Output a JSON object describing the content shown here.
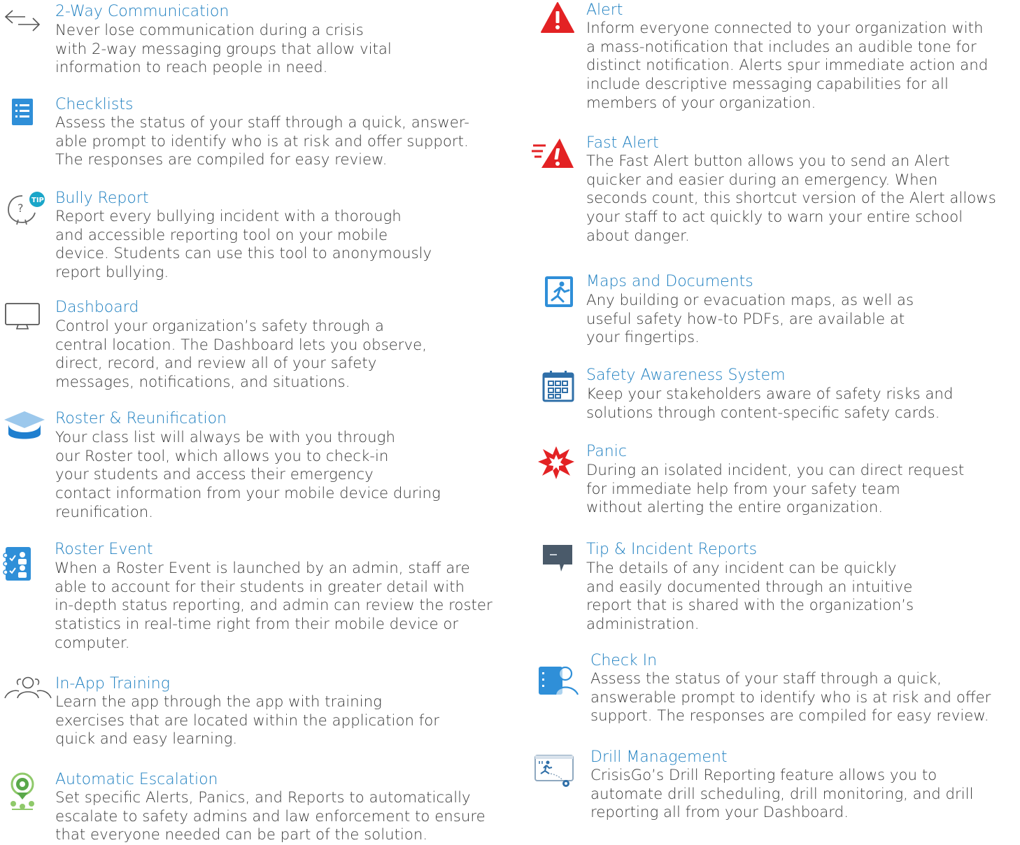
{
  "left_column": [
    {
      "icon": "two-way-arrows-icon",
      "title": "2-Way Communication",
      "lines": [
        "Never lose communication during a crisis",
        "with 2-way messaging groups that allow vital",
        "information to reach people in need."
      ]
    },
    {
      "icon": "checklist-icon",
      "title": "Checklists",
      "lines": [
        "Assess the status of your staff through a quick, answer-",
        "able prompt to identify who is at risk and offer support.",
        "The responses are compiled for easy review."
      ]
    },
    {
      "icon": "tip-bubble-icon",
      "title": "Bully Report",
      "lines": [
        "Report every bullying incident with a thorough",
        "and accessible reporting tool on your mobile",
        "device. Students can use this tool to anonymously",
        "report bullying."
      ]
    },
    {
      "icon": "monitor-icon",
      "title": "Dashboard",
      "lines": [
        "Control your organization’s safety through a",
        "central location. The Dashboard lets you observe,",
        "direct, record, and review all of your safety",
        "messages, notifications, and situations."
      ]
    },
    {
      "icon": "graduation-cap-icon",
      "title": "Roster & Reunification",
      "lines": [
        "Your class list will always be with you through",
        "our Roster tool, which allows you to check-in",
        "your students and access their emergency",
        "contact information from your mobile device during",
        "reunification."
      ]
    },
    {
      "icon": "roster-notebook-icon",
      "title": "Roster Event",
      "lines": [
        "When a Roster Event is launched by an admin, staff are",
        "able to account for their students in greater detail with",
        "in-depth status reporting, and admin can review the roster",
        "statistics in real-time right from their mobile device or",
        "computer."
      ]
    },
    {
      "icon": "people-group-icon",
      "title": "In-App Training",
      "lines": [
        "Learn the app through the app with training",
        "exercises that are located within the application for",
        "quick and easy learning."
      ]
    },
    {
      "icon": "location-pins-icon",
      "title": "Automatic Escalation",
      "lines": [
        "Set specific Alerts, Panics, and Reports to automatically",
        "escalate to safety admins and law enforcement to ensure",
        "that everyone needed can be part of the solution."
      ]
    }
  ],
  "right_column": [
    {
      "icon": "alert-triangle-icon",
      "title": "Alert",
      "lines": [
        "Inform everyone connected to your organization with",
        "a mass-notification that includes an audible tone for",
        "distinct notification. Alerts spur immediate action and",
        "include descriptive messaging capabilities for all",
        "members of your organization."
      ]
    },
    {
      "icon": "fast-alert-icon",
      "title": "Fast Alert",
      "lines": [
        "The Fast Alert button allows you to send an Alert",
        "quicker and easier during an emergency. When",
        "seconds count, this shortcut version of the Alert allows",
        "your staff to act quickly to warn your entire school",
        "about danger."
      ]
    },
    {
      "icon": "evacuation-runner-icon",
      "title": "Maps and Documents",
      "lines": [
        "Any building or evacuation maps, as well as",
        "useful safety how-to PDFs, are available at",
        "your fingertips."
      ]
    },
    {
      "icon": "calendar-grid-icon",
      "title": "Safety Awareness System",
      "lines": [
        "Keep your stakeholders aware of safety risks and",
        "solutions through content-specific safety cards."
      ]
    },
    {
      "icon": "panic-burst-icon",
      "title": "Panic",
      "lines": [
        "During an isolated incident, you can direct request",
        "for immediate help from your safety team",
        "without alerting the entire organization."
      ]
    },
    {
      "icon": "chat-bubble-icon",
      "title": "Tip & Incident Reports",
      "lines": [
        "The details of any incident can be quickly",
        "and easily documented through an intuitive",
        "report that is shared with the organization’s",
        "administration."
      ]
    },
    {
      "icon": "check-in-person-icon",
      "title": "Check In",
      "lines": [
        "Assess the status of your staff through a quick,",
        "answerable prompt to identify who is at risk and offer",
        "support. The responses are compiled for easy review."
      ]
    },
    {
      "icon": "drill-runner-gear-icon",
      "title": "Drill Management",
      "lines": [
        "CrisisGo’s Drill Reporting feature allows you to",
        "automate drill scheduling, drill monitoring, and drill",
        "reporting all from your Dashboard."
      ]
    }
  ],
  "colors": {
    "title": "#1e7fc0",
    "body": "#3a3a3a",
    "alert_red": "#e32224",
    "icon_blue": "#2f8fd8"
  }
}
